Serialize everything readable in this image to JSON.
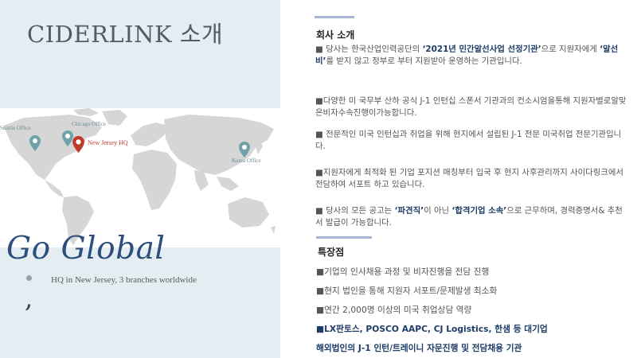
{
  "left": {
    "title": "CIDERLINK 소개",
    "map": {
      "offices": [
        {
          "name": "Seattle Office",
          "color": "#6fa3a8"
        },
        {
          "name": "Chicago Office",
          "color": "#6fa3a8"
        },
        {
          "name": "New Jersey HQ",
          "color": "#c0392b"
        },
        {
          "name": "Korea Office",
          "color": "#6fa3a8"
        }
      ]
    },
    "slogan": "Go Global",
    "hq_text": "HQ in New Jersey, 3 branches worldwide"
  },
  "right": {
    "intro": {
      "heading": "회사 소개",
      "paragraphs": [
        {
          "prefix": "■ 당사는 한국산업인력공단의 ",
          "highlight": "‘2021년 민간알선사업 선정기관’",
          "suffix": "으로 지원자에게 ",
          "highlight2": "‘알선비’",
          "suffix2": "를 받지 않고 정부로 부터 지원받아 운영하는 기관입니다."
        },
        {
          "text": "■다양한 미 국무부 산하 공식 J-1 인턴십 스폰서 기관과의 컨소시엄을통해 지원자별로알맞은비자수속진행이가능합니다."
        },
        {
          "text": "■ 전문적인 미국 인턴십과 취업을 위해 현지에서 설립된 J-1 전문 미국취업 전문기관입니다."
        },
        {
          "text": "■지원자에게 최적화 된 기업 포지션 매칭부터 입국 후 현지 사후관리까지 사이다링크에서 전담하여 서포트 하고 있습니다."
        },
        {
          "prefix": "■ 당사의 모든 공고는 ",
          "highlight": "‘파견직’",
          "suffix": "이 아닌 ",
          "highlight2": "‘합격기업 소속’",
          "suffix2": "으로 근무하며, 경력증명서& 추천서 발급이 가능합니다."
        }
      ]
    },
    "features": {
      "heading": "특장점",
      "items": [
        "■기업의 인사채용 과정 및 비자진행을 전담 진행",
        "■현지 법인을 통해 지원자 서포트/문제발생 최소화",
        "■연간 2,000명 이상의 미국 취업상담 역량",
        "■LX판토스, POSCO AAPC, CJ Logistics, 한샘 등 대기업",
        "해외법인의 J-1 인턴/트레이니 자문진행 및 전담채용 기관"
      ]
    }
  }
}
